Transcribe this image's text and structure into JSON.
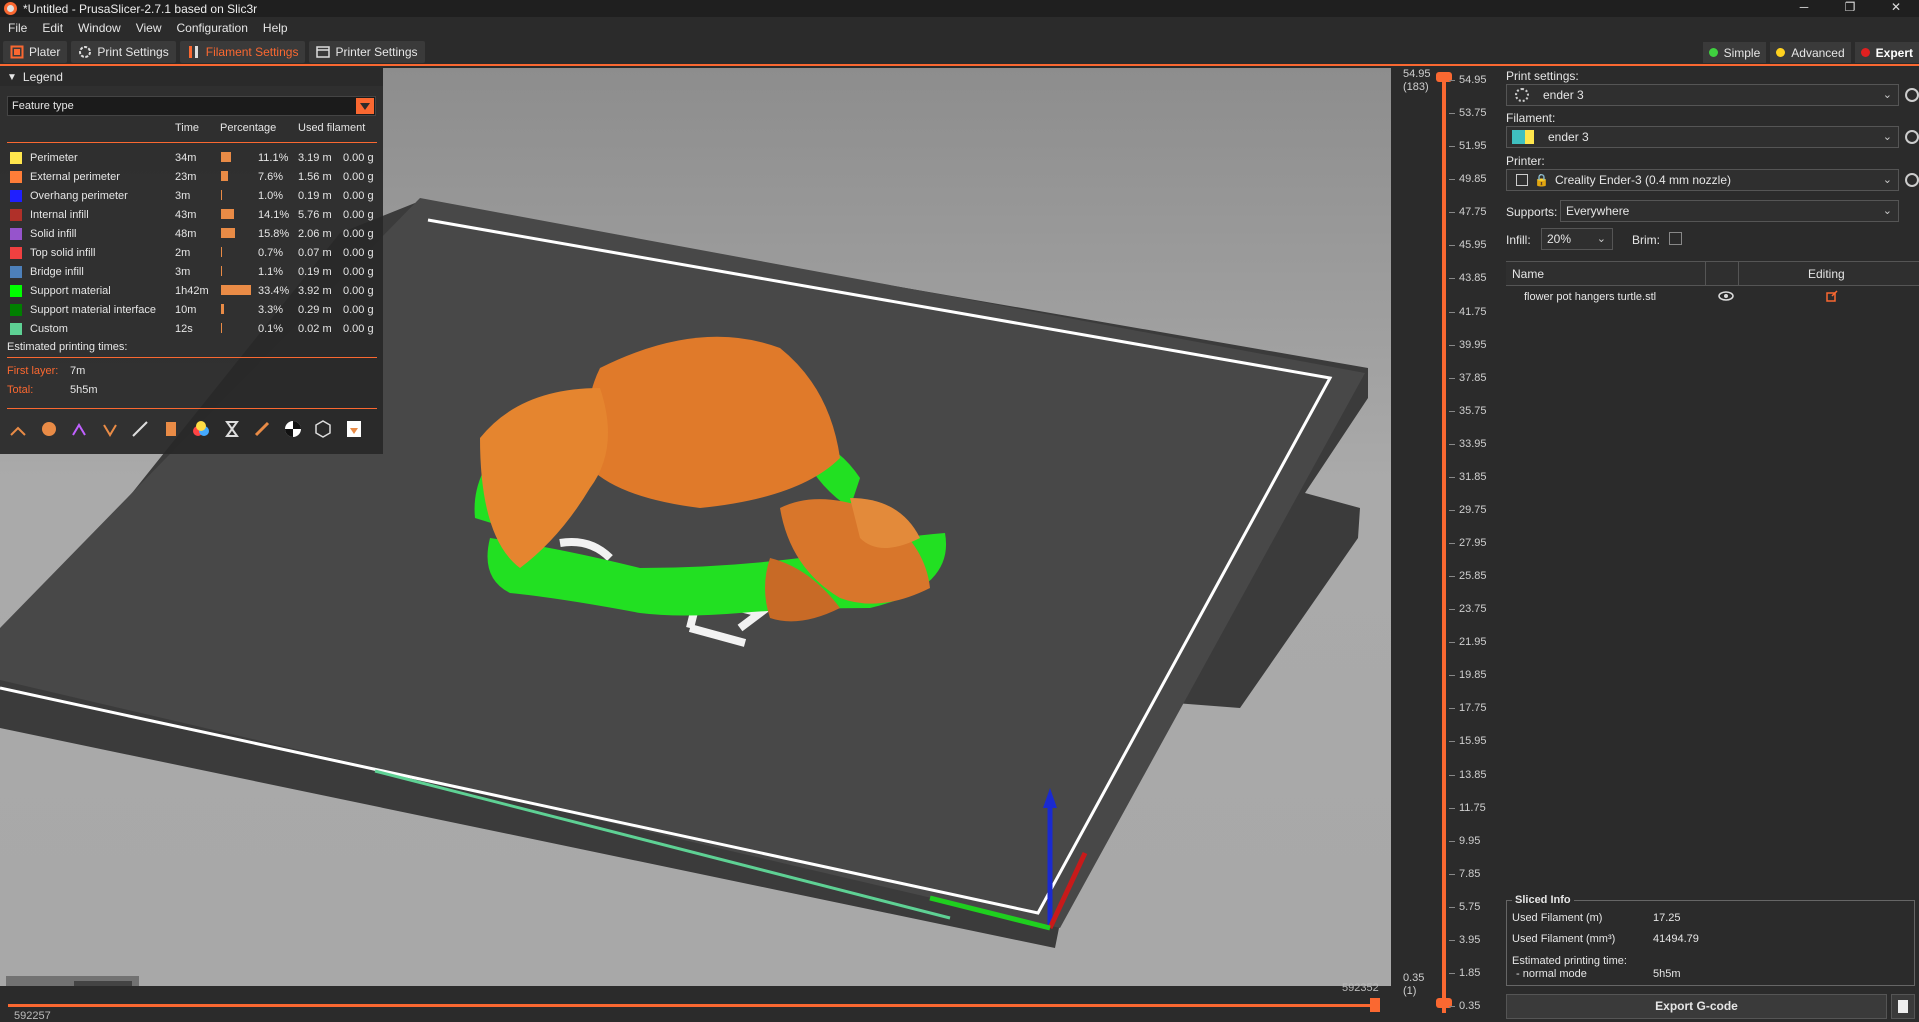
{
  "window": {
    "title": "*Untitled - PrusaSlicer-2.7.1 based on Slic3r",
    "minimize": "─",
    "maximize": "❐",
    "close": "✕"
  },
  "menu": [
    "File",
    "Edit",
    "Window",
    "View",
    "Configuration",
    "Help"
  ],
  "tabs": [
    {
      "label": "Plater",
      "icon": "plater-icon"
    },
    {
      "label": "Print Settings",
      "icon": "print-settings-icon"
    },
    {
      "label": "Filament Settings",
      "icon": "filament-settings-icon"
    },
    {
      "label": "Printer Settings",
      "icon": "printer-settings-icon"
    }
  ],
  "modes": [
    {
      "label": "Simple",
      "color": "#3fd13f"
    },
    {
      "label": "Advanced",
      "color": "#ffd21f"
    },
    {
      "label": "Expert",
      "color": "#e02020"
    }
  ],
  "legend": {
    "title": "Legend",
    "view_type": "Feature type",
    "columns": {
      "time": "Time",
      "percentage": "Percentage",
      "used_filament": "Used filament"
    },
    "rows": [
      {
        "name": "Perimeter",
        "color": "#ffe64d",
        "time": "34m",
        "fraction": 0.111,
        "pct": "11.1%",
        "length": "3.19 m",
        "weight": "0.00 g"
      },
      {
        "name": "External perimeter",
        "color": "#ff7d38",
        "time": "23m",
        "fraction": 0.076,
        "pct": "7.6%",
        "length": "1.56 m",
        "weight": "0.00 g"
      },
      {
        "name": "Overhang perimeter",
        "color": "#1f1fff",
        "time": "3m",
        "fraction": 0.01,
        "pct": "1.0%",
        "length": "0.19 m",
        "weight": "0.00 g"
      },
      {
        "name": "Internal infill",
        "color": "#b03029",
        "time": "43m",
        "fraction": 0.141,
        "pct": "14.1%",
        "length": "5.76 m",
        "weight": "0.00 g"
      },
      {
        "name": "Solid infill",
        "color": "#9654cc",
        "time": "48m",
        "fraction": 0.158,
        "pct": "15.8%",
        "length": "2.06 m",
        "weight": "0.00 g"
      },
      {
        "name": "Top solid infill",
        "color": "#f04040",
        "time": "2m",
        "fraction": 0.007,
        "pct": "0.7%",
        "length": "0.07 m",
        "weight": "0.00 g"
      },
      {
        "name": "Bridge infill",
        "color": "#4d80ba",
        "time": "3m",
        "fraction": 0.011,
        "pct": "1.1%",
        "length": "0.19 m",
        "weight": "0.00 g"
      },
      {
        "name": "Support material",
        "color": "#00ff00",
        "time": "1h42m",
        "fraction": 0.334,
        "pct": "33.4%",
        "length": "3.92 m",
        "weight": "0.00 g"
      },
      {
        "name": "Support material interface",
        "color": "#008000",
        "time": "10m",
        "fraction": 0.033,
        "pct": "3.3%",
        "length": "0.29 m",
        "weight": "0.00 g"
      },
      {
        "name": "Custom",
        "color": "#5ed194",
        "time": "12s",
        "fraction": 0.001,
        "pct": "0.1%",
        "length": "0.02 m",
        "weight": "0.00 g"
      }
    ],
    "estimated_title": "Estimated printing times:",
    "first_layer_label": "First layer:",
    "first_layer_value": "7m",
    "total_label": "Total:",
    "total_value": "5h5m"
  },
  "vertical_slider": {
    "top_value": "54.95",
    "top_layer": "(183)",
    "bottom_value": "0.35",
    "bottom_layer": "(1)",
    "ticks": [
      "54.95",
      "53.75",
      "51.95",
      "49.85",
      "47.75",
      "45.95",
      "43.85",
      "41.75",
      "39.95",
      "37.85",
      "35.75",
      "33.95",
      "31.85",
      "29.75",
      "27.95",
      "25.85",
      "23.75",
      "21.95",
      "19.85",
      "17.75",
      "15.95",
      "13.85",
      "11.75",
      "9.95",
      "7.85",
      "5.75",
      "3.95",
      "1.85",
      "0.35"
    ]
  },
  "horizontal_slider": {
    "right_value": "592352",
    "left_value": "592257"
  },
  "right_panel": {
    "print_settings_label": "Print settings:",
    "print_settings_value": "ender 3",
    "filament_label": "Filament:",
    "filament_value": "ender 3",
    "printer_label": "Printer:",
    "printer_value": "Creality Ender-3 (0.4 mm nozzle)",
    "supports_label": "Supports:",
    "supports_value": "Everywhere",
    "infill_label": "Infill:",
    "infill_value": "20%",
    "brim_label": "Brim:",
    "list_name_header": "Name",
    "list_editing_header": "Editing",
    "object_name": "flower pot hangers turtle.stl",
    "sliced_title": "Sliced Info",
    "used_filament_m_label": "Used Filament (m)",
    "used_filament_m_value": "17.25",
    "used_filament_mm3_label": "Used Filament (mm³)",
    "used_filament_mm3_value": "41494.79",
    "est_time_label": "Estimated printing time:",
    "normal_mode_label": "- normal mode",
    "normal_mode_value": "5h5m",
    "export_label": "Export G-code"
  }
}
